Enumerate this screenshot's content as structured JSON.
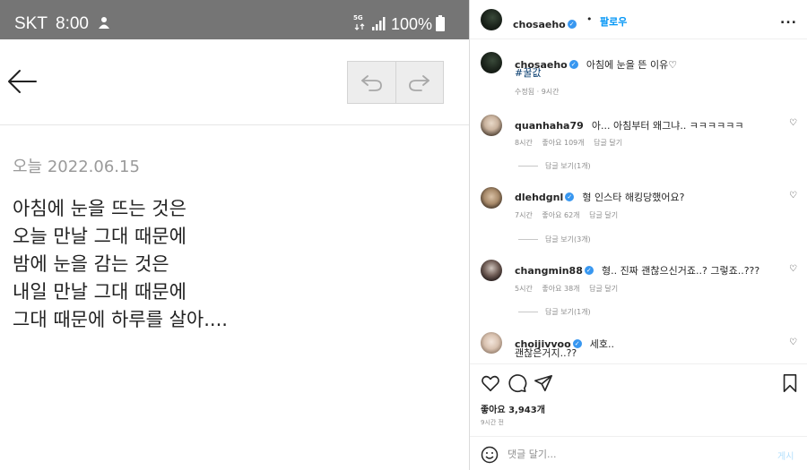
{
  "phone": {
    "status": {
      "carrier": "SKT",
      "time": "8:00",
      "network": "5G",
      "battery": "100%"
    },
    "memo": {
      "date": "오늘 2022.06.15",
      "lines": [
        "아침에 눈을 뜨는 것은",
        "오늘 만날 그대 때문에",
        "밤에 눈을 감는 것은",
        "내일 만날 그대 때문에",
        "그대 때문에 하루를 살아...."
      ]
    }
  },
  "post": {
    "author": "chosaeho",
    "separator": "•",
    "follow_label": "팔로우",
    "more_label": "...",
    "caption": {
      "user": "chosaeho",
      "text": "아침에 눈을 뜬 이유♡",
      "hashtag": "#꿀값",
      "meta": "수정됨 · 9시간"
    },
    "comments": [
      {
        "user": "quanhaha79",
        "verified": false,
        "text": "아... 아침부터 왜그냐.. ㅋㅋㅋㅋㅋㅋ",
        "time": "8시간",
        "likes": "좋아요 109개",
        "reply": "답글 달기",
        "replies": "답글 보기(1개)"
      },
      {
        "user": "dlehdgnl",
        "verified": true,
        "text": "형 인스타 해킹당했어요?",
        "time": "7시간",
        "likes": "좋아요 62개",
        "reply": "답글 달기",
        "replies": "답글 보기(3개)"
      },
      {
        "user": "changmin88",
        "verified": true,
        "text": "형.. 진짜 괜찮으신거죠..? 그렇죠..???",
        "time": "5시간",
        "likes": "좋아요 38개",
        "reply": "답글 달기",
        "replies": "답글 보기(1개)"
      },
      {
        "user": "choijivvoo",
        "verified": true,
        "text": "세호..",
        "text2": "괜찮은거지..??"
      }
    ],
    "likes": "좋아요 3,943개",
    "posted": "9시간 전",
    "comment_placeholder": "댓글 달기...",
    "post_label": "게시",
    "colors": {
      "accent": "#0095f6",
      "verified": "#3897f0",
      "status_bar": "#757575"
    }
  }
}
